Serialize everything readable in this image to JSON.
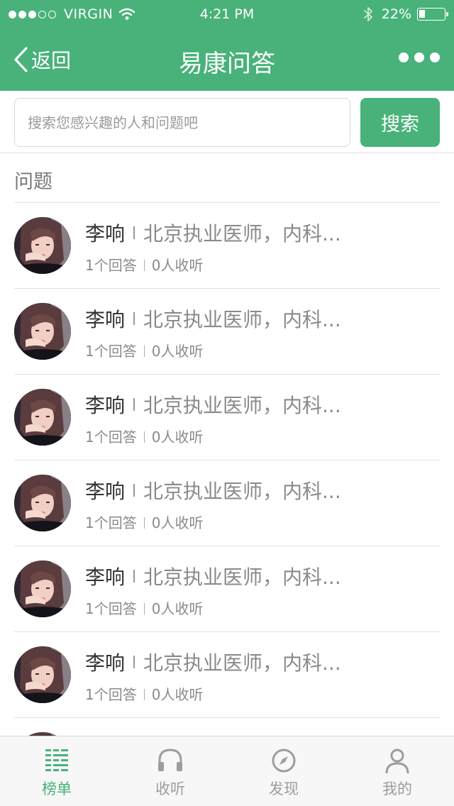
{
  "status_bar": {
    "carrier": "VIRGIN",
    "time": "4:21 PM",
    "battery": "22%",
    "battery_level": 0.22,
    "signal_bars_filled": 3,
    "signal_bars_total": 5
  },
  "nav": {
    "back_label": "返回",
    "title": "易康问答",
    "more_icon": "more-dots-icon"
  },
  "search": {
    "placeholder": "搜索您感兴趣的人和问题吧",
    "button_label": "搜索"
  },
  "section": {
    "title": "问题"
  },
  "questions": [
    {
      "name": "李响",
      "desc": "北京执业医师，内科...",
      "answers": "1个回答",
      "listeners": "0人收听"
    },
    {
      "name": "李响",
      "desc": "北京执业医师，内科...",
      "answers": "1个回答",
      "listeners": "0人收听"
    },
    {
      "name": "李响",
      "desc": "北京执业医师，内科...",
      "answers": "1个回答",
      "listeners": "0人收听"
    },
    {
      "name": "李响",
      "desc": "北京执业医师，内科...",
      "answers": "1个回答",
      "listeners": "0人收听"
    },
    {
      "name": "李响",
      "desc": "北京执业医师，内科...",
      "answers": "1个回答",
      "listeners": "0人收听"
    },
    {
      "name": "李响",
      "desc": "北京执业医师，内科...",
      "answers": "1个回答",
      "listeners": "0人收听"
    },
    {
      "name": "",
      "desc": "",
      "answers": "",
      "listeners": ""
    }
  ],
  "tabbar": {
    "tabs": [
      {
        "label": "榜单",
        "icon": "ranking-list-icon",
        "active": true
      },
      {
        "label": "收听",
        "icon": "headphones-icon",
        "active": false
      },
      {
        "label": "发现",
        "icon": "compass-icon",
        "active": false
      },
      {
        "label": "我的",
        "icon": "person-icon",
        "active": false
      }
    ]
  },
  "colors": {
    "brand_green": "#48b27a",
    "inactive_gray": "#9d9d9d"
  }
}
